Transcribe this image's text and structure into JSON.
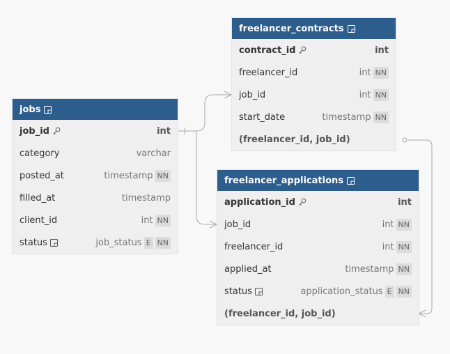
{
  "tables": {
    "freelancer_contracts": {
      "name": "freelancer_contracts",
      "rows": [
        {
          "name": "contract_id",
          "type": "int"
        },
        {
          "name": "freelancer_id",
          "type": "int",
          "badges": [
            "NN"
          ]
        },
        {
          "name": "job_id",
          "type": "int",
          "badges": [
            "NN"
          ]
        },
        {
          "name": "start_date",
          "type": "timestamp",
          "badges": [
            "NN"
          ]
        },
        {
          "name": "(freelancer_id, job_id)"
        }
      ]
    },
    "jobs": {
      "name": "jobs",
      "rows": [
        {
          "name": "job_id",
          "type": "int"
        },
        {
          "name": "category",
          "type": "varchar"
        },
        {
          "name": "posted_at",
          "type": "timestamp",
          "badges": [
            "NN"
          ]
        },
        {
          "name": "filled_at",
          "type": "timestamp"
        },
        {
          "name": "client_id",
          "type": "int",
          "badges": [
            "NN"
          ]
        },
        {
          "name": "status",
          "type": "job_status",
          "badges": [
            "E",
            "NN"
          ]
        }
      ]
    },
    "freelancer_applications": {
      "name": "freelancer_applications",
      "rows": [
        {
          "name": "application_id",
          "type": "int"
        },
        {
          "name": "job_id",
          "type": "int",
          "badges": [
            "NN"
          ]
        },
        {
          "name": "freelancer_id",
          "type": "int",
          "badges": [
            "NN"
          ]
        },
        {
          "name": "applied_at",
          "type": "timestamp",
          "badges": [
            "NN"
          ]
        },
        {
          "name": "status",
          "type": "application_status",
          "badges": [
            "E",
            "NN"
          ]
        },
        {
          "name": "(freelancer_id, job_id)"
        }
      ]
    }
  },
  "colors": {
    "header": "#2c5d8c",
    "body": "#efefef",
    "background": "#f8f8f8",
    "edge": "#a9a9a9"
  }
}
